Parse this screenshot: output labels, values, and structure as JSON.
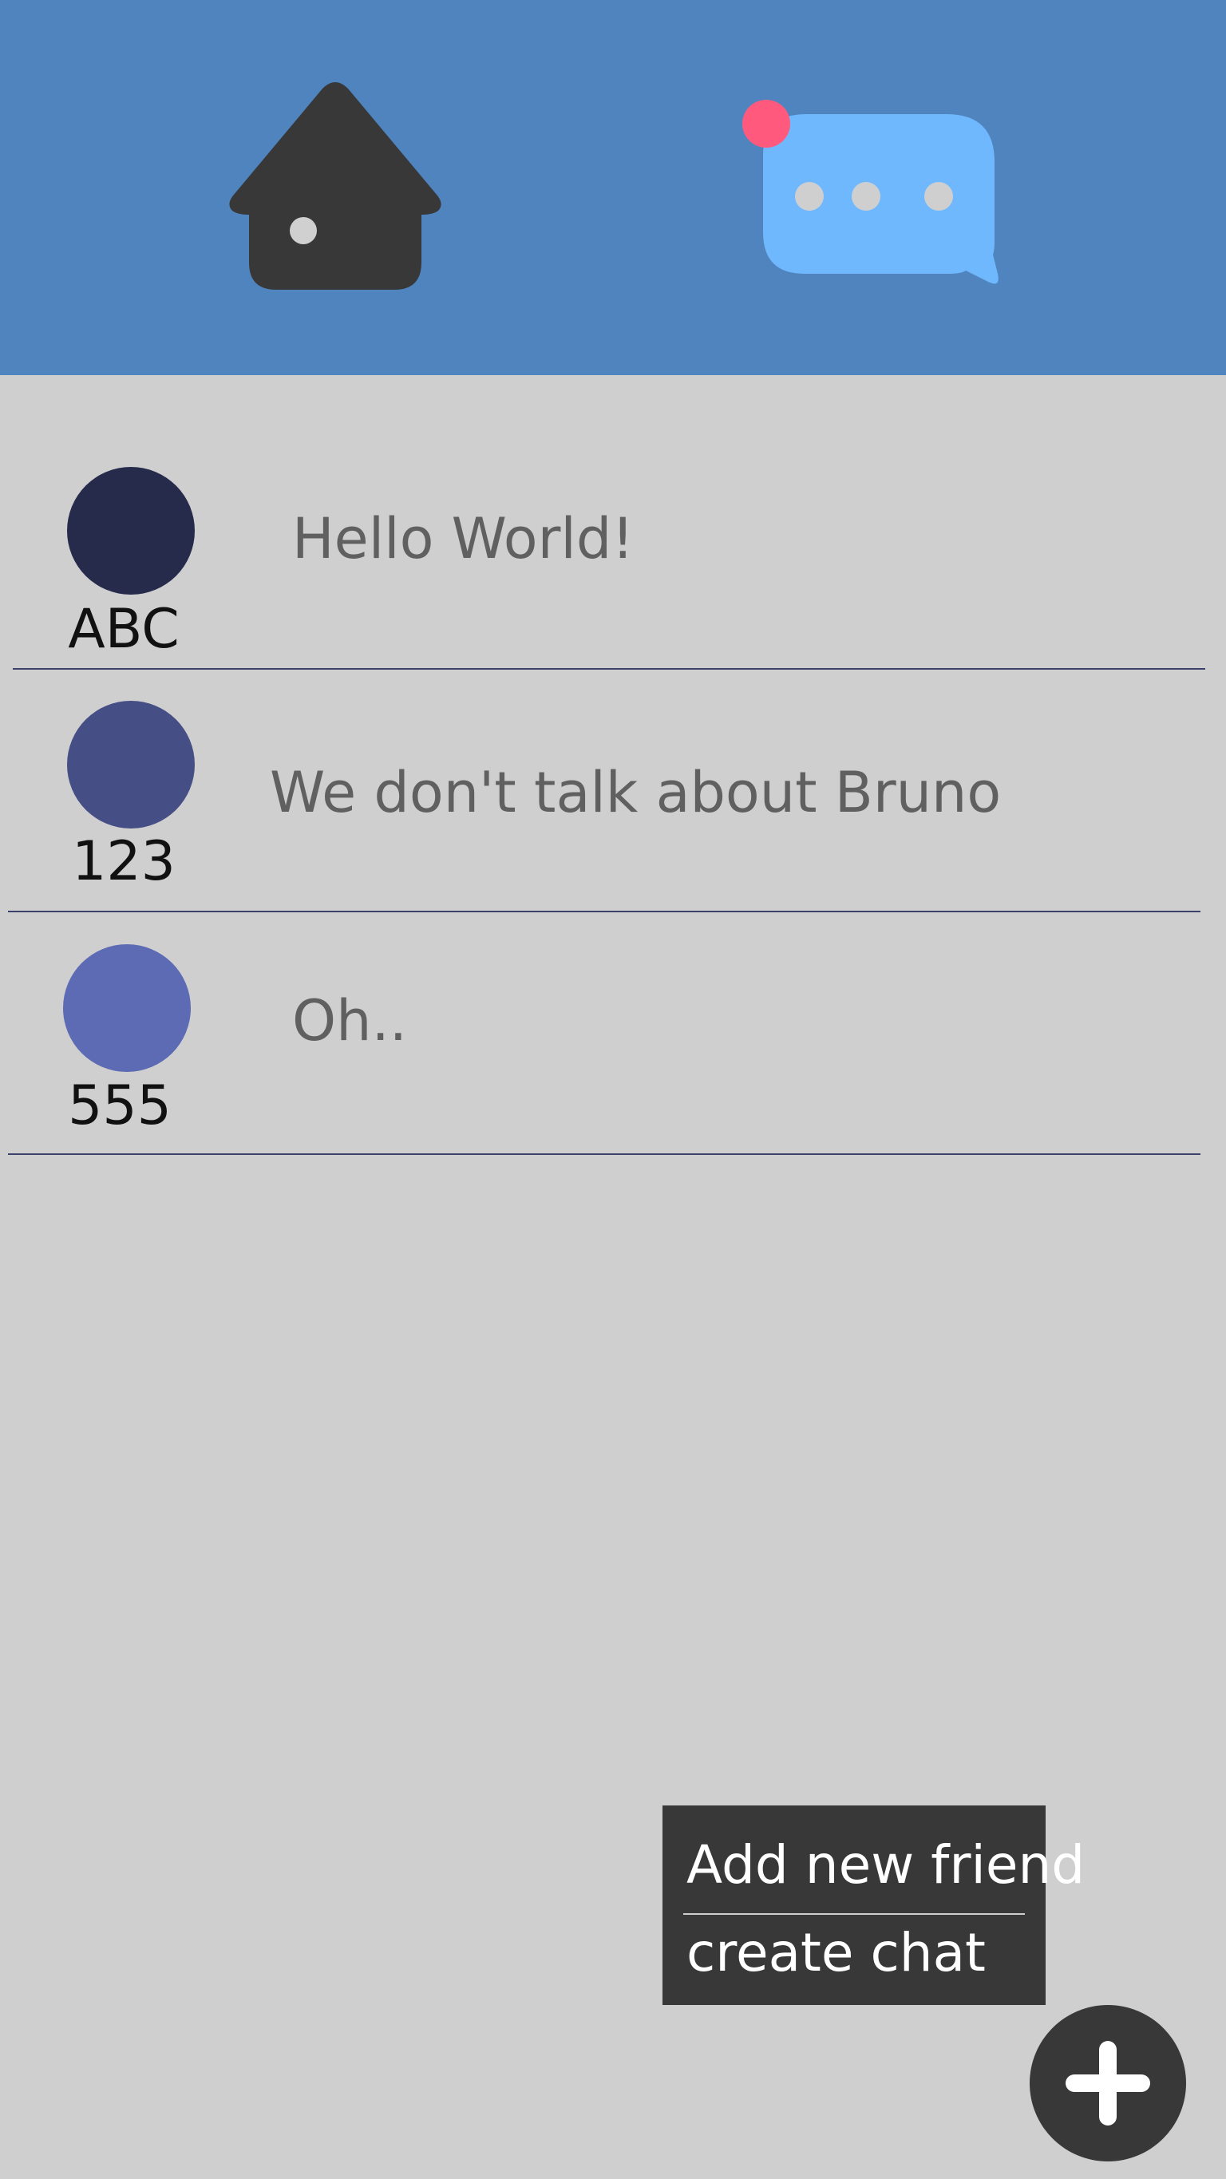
{
  "colors": {
    "topbar": "#5084be",
    "background": "#cfcfcf",
    "home_icon": "#383838",
    "chat_icon": "#6fb8fe",
    "notification_dot": "#ff5a7e",
    "divider": "#3c416c",
    "menu": "#383838"
  },
  "nav": {
    "home_icon": "home-icon",
    "chat_icon": "chat-bubble-icon",
    "chat_has_notification": true
  },
  "chats": [
    {
      "name": "ABC",
      "preview": "Hello World!",
      "avatar_color": "#262a4b"
    },
    {
      "name": "123",
      "preview": "We don't talk about Bruno",
      "avatar_color": "#454f85"
    },
    {
      "name": "555",
      "preview": "Oh..",
      "avatar_color": "#5d6bb4"
    }
  ],
  "menu": {
    "items": [
      {
        "label": "Add new friend"
      },
      {
        "label": "create chat"
      }
    ]
  },
  "fab": {
    "icon": "plus-icon"
  }
}
